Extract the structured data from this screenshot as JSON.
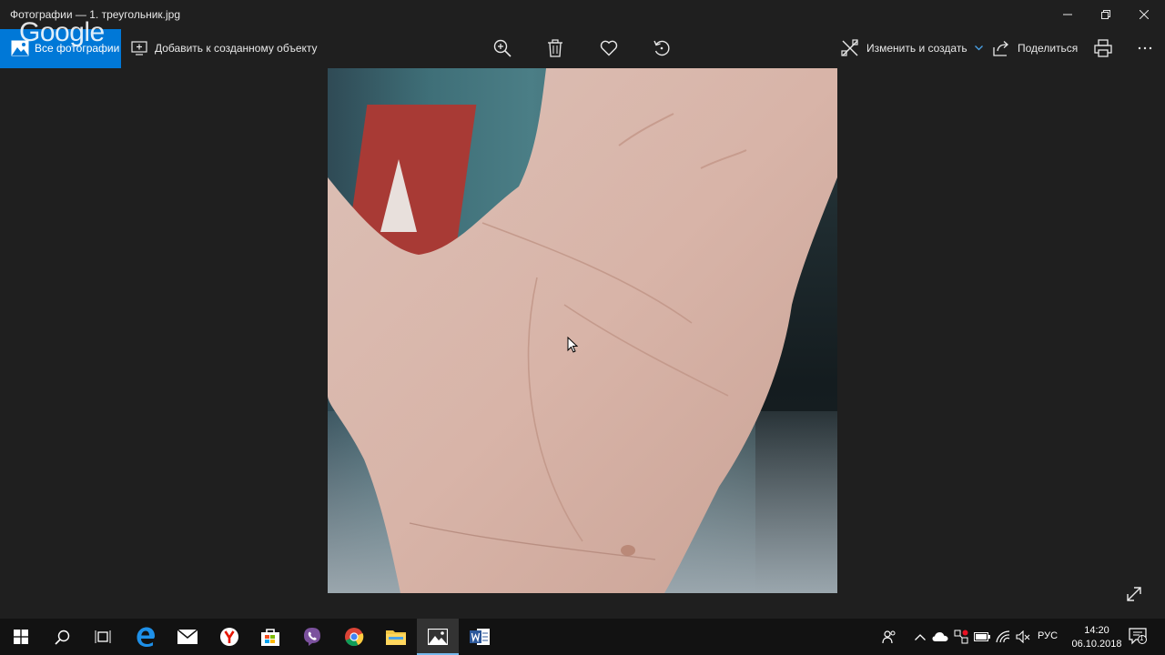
{
  "window": {
    "title": "Фотографии — 1. треугольник.jpg"
  },
  "watermark": "Google",
  "toolbar": {
    "all_photos": "Все фотографии",
    "add_to_creation": "Добавить к созданному объекту",
    "edit_create": "Изменить и создать",
    "share": "Поделиться"
  },
  "icons": {
    "zoom": "zoom-in-icon",
    "delete": "trash-icon",
    "favorite": "heart-icon",
    "rotate": "rotate-icon",
    "print": "printer-icon",
    "more": "ellipsis-icon",
    "expand": "fullscreen-icon"
  },
  "colors": {
    "accent": "#0078d7",
    "background": "#1f1f1f",
    "taskbar": "#121212"
  },
  "taskbar": {
    "language": "РУС",
    "time": "14:20",
    "date": "06.10.2018",
    "notifications": "1"
  }
}
